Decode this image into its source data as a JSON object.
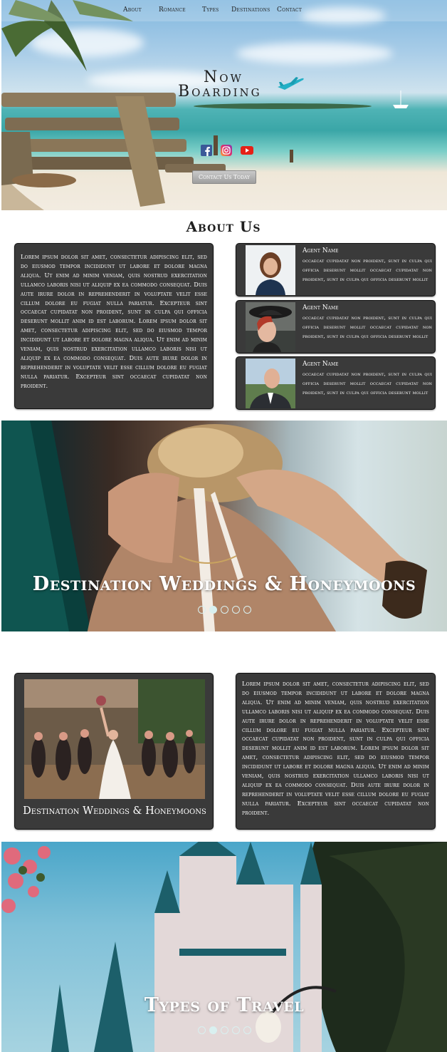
{
  "nav": {
    "items": [
      "About",
      "Romance",
      "Types",
      "Destinations",
      "Contact"
    ]
  },
  "brand": {
    "line1": "Now",
    "line2": "Boarding"
  },
  "social": {
    "icons": [
      "facebook-icon",
      "instagram-icon",
      "youtube-icon"
    ],
    "colors": {
      "facebook": "#3b5998",
      "instagram": "#c13584",
      "youtube": "#e62117"
    }
  },
  "hero": {
    "cta_label": "Contact Us Today"
  },
  "about": {
    "title": "About Us",
    "body": "Lorem ipsum dolor sit amet, consectetur adipiscing elit, sed do eiusmod tempor incididunt ut labore et dolore magna aliqua. Ut enim ad minim veniam, quis nostrud exercitation ullamco laboris nisi ut aliquip ex ea commodo consequat. Duis aute irure dolor in reprehenderit in voluptate velit esse cillum dolore eu fugiat nulla pariatur. Excepteur sint occaecat cupidatat non proident, sunt in culpa qui officia deserunt mollit anim id est laborum. Lorem ipsum dolor sit amet, consectetur adipiscing elit, sed do eiusmod tempor incididunt ut labore et dolore magna aliqua. Ut enim ad minim veniam, quis nostrud exercitation ullamco laboris nisi ut aliquip ex ea commodo consequat. Duis aute irure dolor in reprehenderit in voluptate velit esse cillum dolore eu fugiat nulla pariatur. Excepteur sint occaecat cupidatat non proident.",
    "agents": [
      {
        "name": "Agent Name",
        "desc": "occaecat cupidatat non proident, sunt in culpa qui officia deserunt mollit occaecat cupidatat non proident, sunt in culpa qui officia deserunt mollit"
      },
      {
        "name": "Agent Name",
        "desc": "occaecat cupidatat non proident, sunt in culpa qui officia deserunt mollit occaecat cupidatat non proident, sunt in culpa qui officia deserunt mollit"
      },
      {
        "name": "Agent Name",
        "desc": "occaecat cupidatat non proident, sunt in culpa qui officia deserunt mollit occaecat cupidatat non proident, sunt in culpa qui officia deserunt mollit"
      }
    ]
  },
  "slider1": {
    "title": "Destination Weddings & Honeymoons",
    "dot_count": 5,
    "active_dot": 2
  },
  "weddings": {
    "caption": "Destination Weddings & Honeymoons",
    "body": "Lorem ipsum dolor sit amet, consectetur adipiscing elit, sed do eiusmod tempor incididunt ut labore et dolore magna aliqua. Ut enim ad minim veniam, quis nostrud exercitation ullamco laboris nisi ut aliquip ex ea commodo consequat. Duis aute irure dolor in reprehenderit in voluptate velit esse cillum dolore eu fugiat nulla pariatur. Excepteur sint occaecat cupidatat non proident, sunt in culpa qui officia deserunt mollit anim id est laborum. Lorem ipsum dolor sit amet, consectetur adipiscing elit, sed do eiusmod tempor incididunt ut labore et dolore magna aliqua. Ut enim ad minim veniam, quis nostrud exercitation ullamco laboris nisi ut aliquip ex ea commodo consequat. Duis aute irure dolor in reprehenderit in voluptate velit esse cillum dolore eu fugiat nulla pariatur. Excepteur sint occaecat cupidatat non proident."
  },
  "slider2": {
    "title": "Types of Travel",
    "dot_count": 5,
    "active_dot": 2
  }
}
